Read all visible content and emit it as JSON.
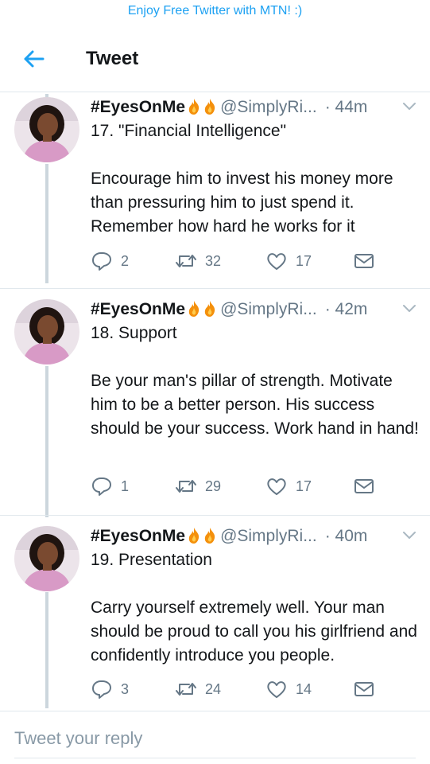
{
  "banner": {
    "text": "Enjoy Free Twitter with MTN! :)"
  },
  "header": {
    "title": "Tweet",
    "back_icon": "arrow-left-icon"
  },
  "colors": {
    "accent": "#1da1f2",
    "muted": "#657786",
    "thread": "#ccd6dd"
  },
  "tweets": [
    {
      "name": "#EyesOnMe",
      "emoji": [
        "fire-icon",
        "fire-icon"
      ],
      "handle": "@SimplyRi...",
      "time": "· 44m",
      "headline": "17. \"Financial Intelligence\"",
      "body": "Encourage him to invest his money more than pressuring him to just spend it. Remember how hard he works for it",
      "replies": "2",
      "retweets": "32",
      "likes": "17"
    },
    {
      "name": "#EyesOnMe",
      "emoji": [
        "fire-icon",
        "fire-icon"
      ],
      "handle": "@SimplyRi...",
      "time": "· 42m",
      "headline": "18. Support",
      "body": "Be your man's pillar of strength. Motivate him to be a better person. His success should be your success. Work hand in hand!",
      "replies": "1",
      "retweets": "29",
      "likes": "17"
    },
    {
      "name": "#EyesOnMe",
      "emoji": [
        "fire-icon",
        "fire-icon"
      ],
      "handle": "@SimplyRi...",
      "time": "· 40m",
      "headline": "19. Presentation",
      "body": "Carry yourself extremely well. Your man should be proud to call you his girlfriend and confidently introduce you people.",
      "replies": "3",
      "retweets": "24",
      "likes": "14"
    }
  ],
  "reply": {
    "placeholder": "Tweet your reply"
  }
}
